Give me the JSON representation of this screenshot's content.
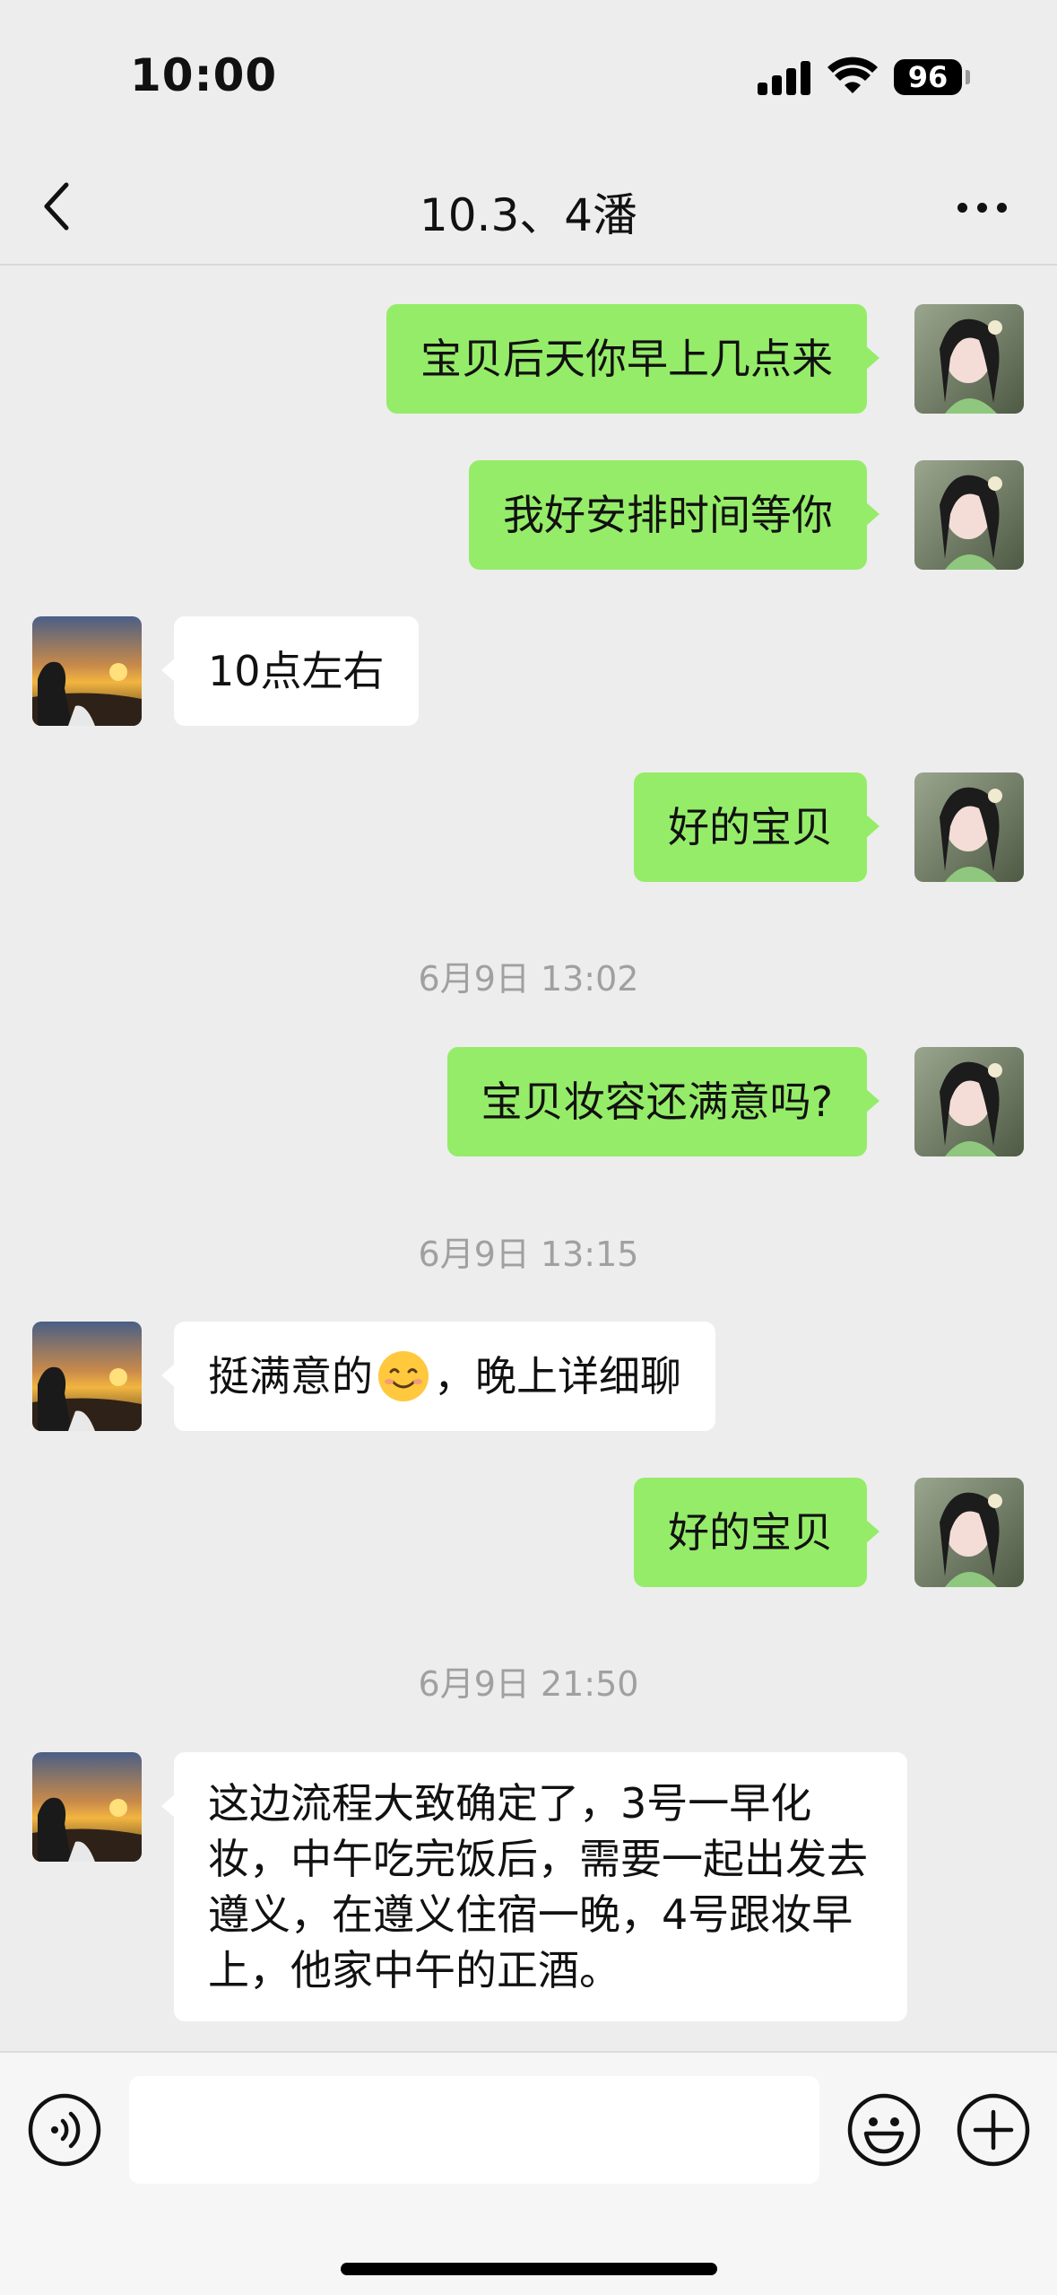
{
  "status_bar": {
    "time": "10:00",
    "battery": "96"
  },
  "header": {
    "title": "10.3、4潘"
  },
  "messages": {
    "m1": "宝贝后天你早上几点来",
    "m2": "我好安排时间等你",
    "m3": "10点左右",
    "m4": "好的宝贝",
    "t1": "6月9日 13:02",
    "m5": "宝贝妆容还满意吗?",
    "t2": "6月9日 13:15",
    "m6_a": "挺满意的",
    "m6_emoji": "smiling-face-emoji",
    "m6_b": "，晚上详细聊",
    "m7": "好的宝贝",
    "t3": "6月9日 21:50",
    "m8": "这边流程大致确定了，3号一早化妆，中午吃完饭后，需要一起出发去遵义，在遵义住宿一晚，4号跟妆早上，他家中午的正酒。"
  },
  "input": {
    "value": "",
    "placeholder": ""
  },
  "icons": {
    "back": "chevron-left-icon",
    "more": "more-dots-icon",
    "voice": "voice-input-icon",
    "emoji": "emoji-icon",
    "plus": "plus-icon"
  },
  "colors": {
    "my_bubble": "#95ec69",
    "their_bubble": "#ffffff",
    "background": "#ededed",
    "timestamp": "#a0a0a0"
  }
}
